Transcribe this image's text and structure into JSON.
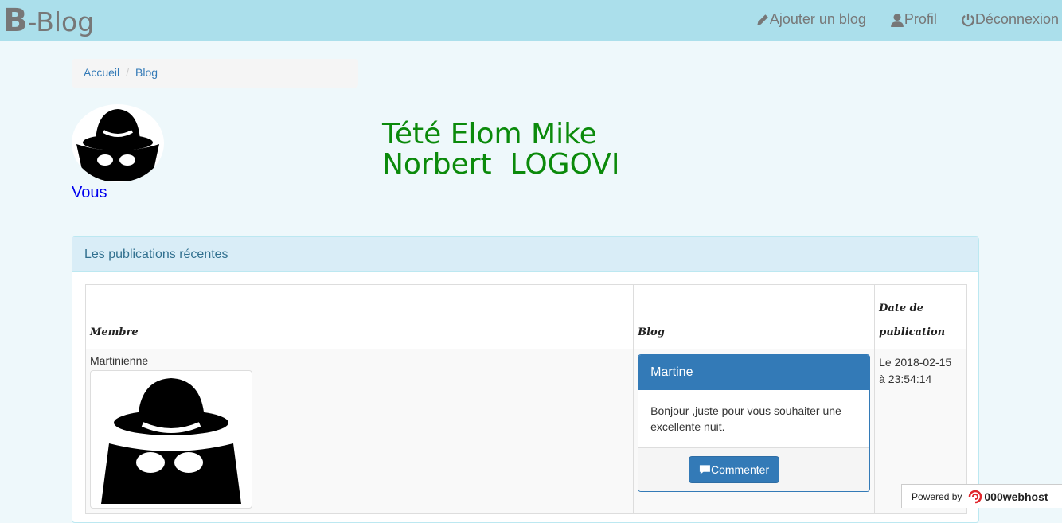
{
  "brand": {
    "letter": "B",
    "rest": "-Blog"
  },
  "nav": {
    "add_blog": "Ajouter un blog",
    "profile": "Profil",
    "logout": "Déconnexion"
  },
  "breadcrumb": {
    "home": "Accueil",
    "current": "Blog"
  },
  "profile": {
    "you_label": "Vous",
    "name_line1": "Tété Elom Mike",
    "name_line2": "Norbert  LOGOVI"
  },
  "panel": {
    "title": "Les publications récentes"
  },
  "table": {
    "headers": {
      "member": "Membre",
      "blog": "Blog",
      "date_line1": "Date de",
      "date_line2": "publication"
    },
    "rows": [
      {
        "member": "Martinienne",
        "blog_title": "Martine",
        "blog_text": "Bonjour ,juste pour vous souhaiter une excellente nuit.",
        "comment_label": "Commenter",
        "date_line1": "Le 2018-02-15",
        "date_line2": "à 23:54:14"
      }
    ]
  },
  "footer_badge": {
    "powered_by": "Powered by",
    "host": "000webhost"
  },
  "icons": [
    "pencil-icon",
    "user-icon",
    "power-icon",
    "comment-icon",
    "spy-avatar-icon"
  ]
}
